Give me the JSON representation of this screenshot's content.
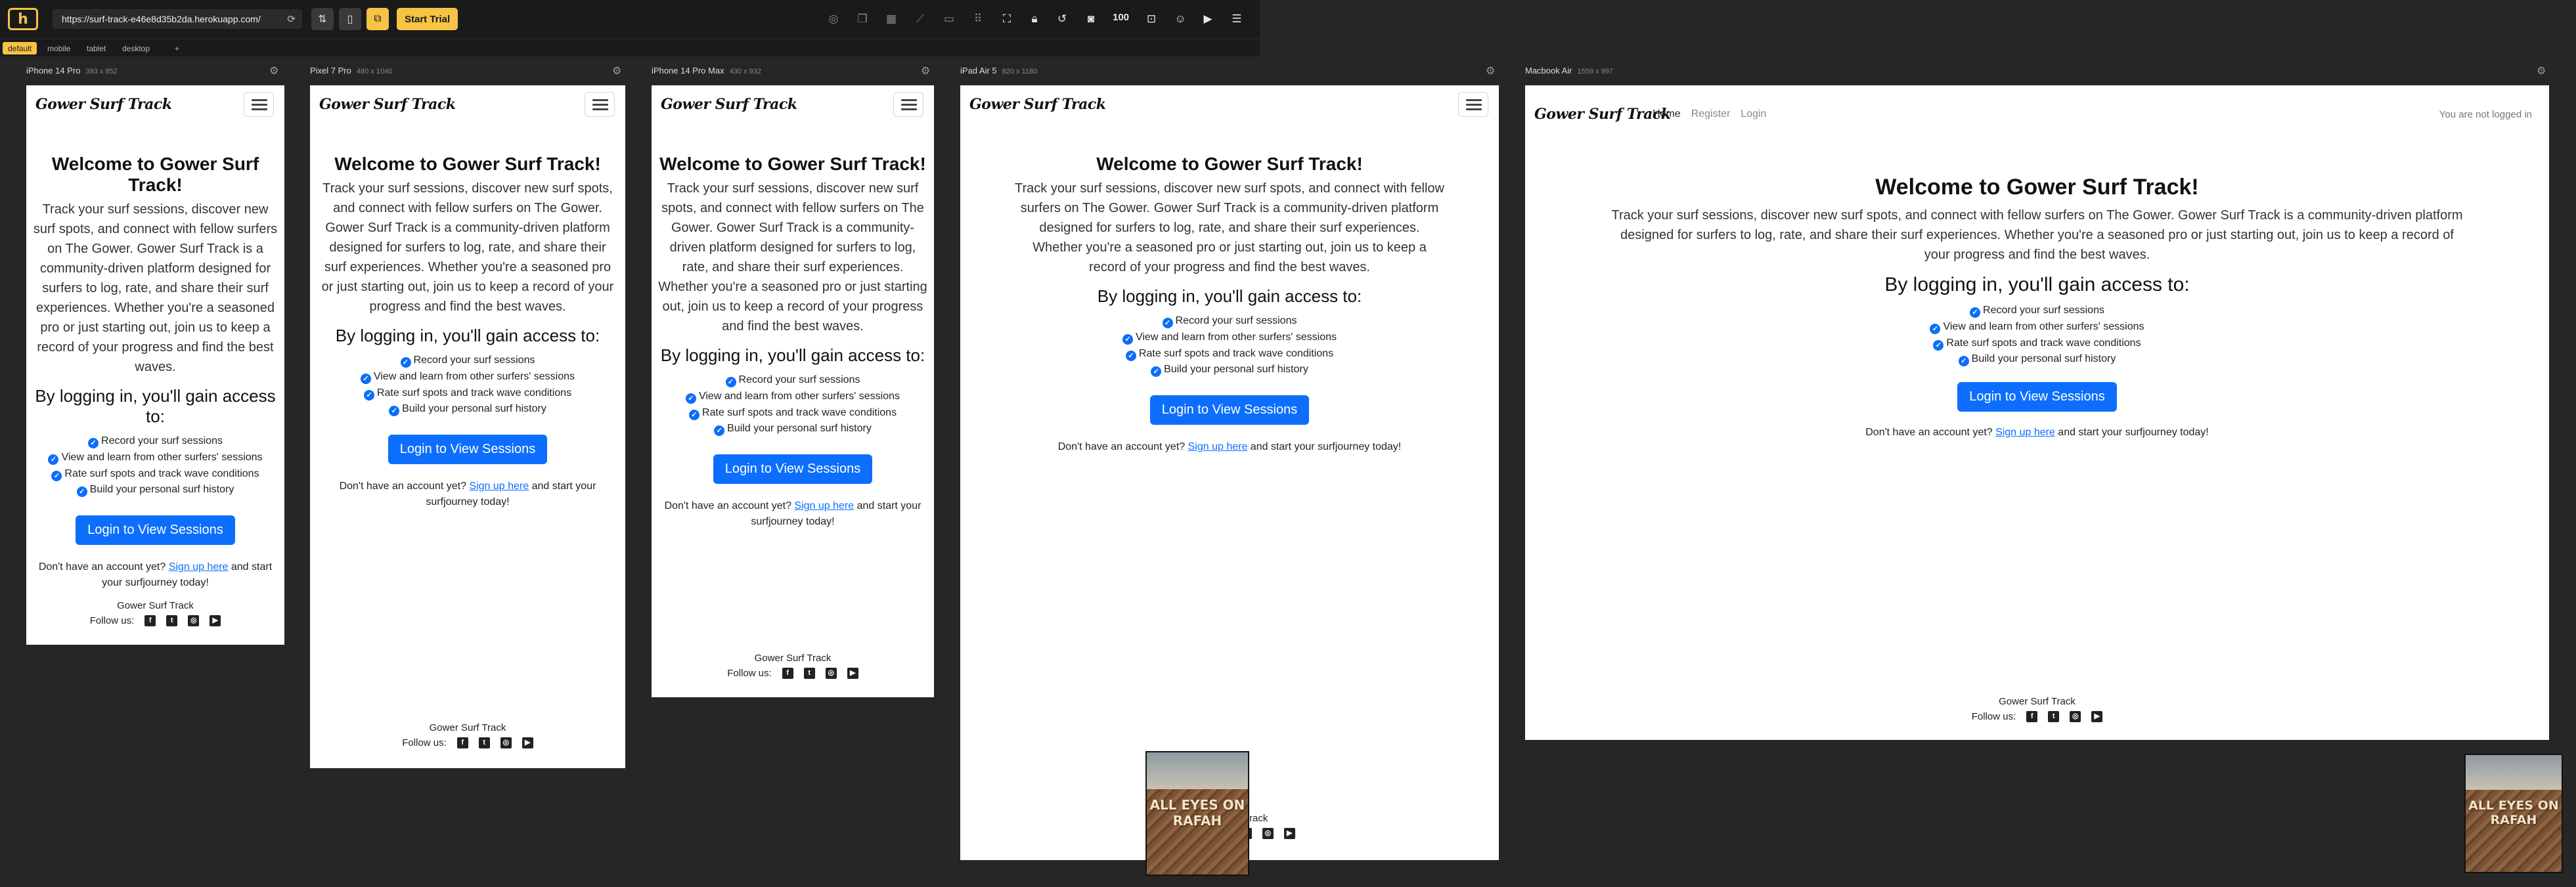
{
  "app": {
    "url": "https://surf-track-e46e8d35b2da.herokuapp.com/",
    "start_trial": "Start Trial",
    "zoom": "100",
    "tabs": [
      "default",
      "mobile",
      "tablet",
      "desktop"
    ],
    "add_tab": "+"
  },
  "devices": [
    {
      "name": "iPhone 14 Pro",
      "dims": "393 x 852"
    },
    {
      "name": "Pixel 7 Pro",
      "dims": "480 x 1040"
    },
    {
      "name": "iPhone 14 Pro Max",
      "dims": "430 x 932"
    },
    {
      "name": "iPad Air 5",
      "dims": "820 x 1180"
    },
    {
      "name": "Macbook Air",
      "dims": "1559 x 997"
    }
  ],
  "site": {
    "brand": "Gower Surf Track",
    "nav": [
      "Home",
      "Register",
      "Login"
    ],
    "not_logged_in": "You are not logged in",
    "title": "Welcome to Gower Surf Track!",
    "lead": "Track your surf sessions, discover new surf spots, and connect with fellow surfers on The Gower. Gower Surf Track is a community-driven platform designed for surfers to log, rate, and share their surf experiences. Whether you're a seasoned pro or just starting out, join us to keep a record of your progress and find the best waves.",
    "access_heading": "By logging in, you'll gain access to:",
    "features": [
      "Record your surf sessions",
      "View and learn from other surfers' sessions",
      "Rate surf spots and track wave conditions",
      "Build your personal surf history"
    ],
    "cta": "Login to View Sessions",
    "signup_before": "Don't have an account yet? ",
    "signup_link": "Sign up here",
    "signup_after": " and start your surfjourney today!",
    "footer_brand": "Gower Surf Track",
    "follow": "Follow us:",
    "thumbnail_text": "ALL EYES ON RAFAH"
  }
}
